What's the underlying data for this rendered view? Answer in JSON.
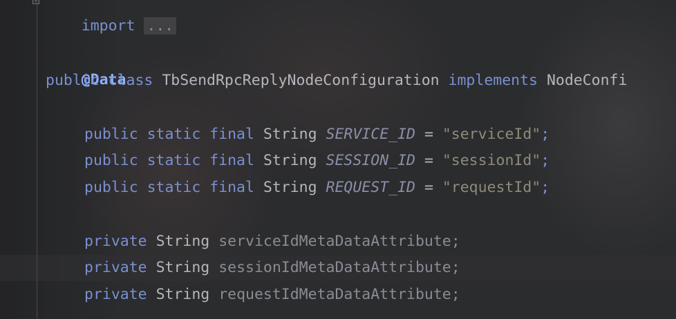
{
  "editor": {
    "import_line": {
      "keyword": "import",
      "folded": "..."
    },
    "annotation": "@Data",
    "class_decl": {
      "kw1": "public",
      "kw2": "class",
      "name": "TbSendRpcReplyNodeConfiguration",
      "kw3": "implements",
      "iface": "NodeConfi"
    },
    "constants": [
      {
        "mods": "public static final",
        "type": "String",
        "name": "SERVICE_ID",
        "eq": "=",
        "value": "\"serviceId\"",
        "semi": ";"
      },
      {
        "mods": "public static final",
        "type": "String",
        "name": "SESSION_ID",
        "eq": "=",
        "value": "\"sessionId\"",
        "semi": ";"
      },
      {
        "mods": "public static final",
        "type": "String",
        "name": "REQUEST_ID",
        "eq": "=",
        "value": "\"requestId\"",
        "semi": ";"
      }
    ],
    "fields": [
      {
        "mod": "private",
        "type": "String",
        "name": "serviceIdMetaDataAttribute;"
      },
      {
        "mod": "private",
        "type": "String",
        "name": "sessionIdMetaDataAttribute;"
      },
      {
        "mod": "private",
        "type": "String",
        "name": "requestIdMetaDataAttribute;"
      }
    ],
    "fold_marker": "-"
  }
}
